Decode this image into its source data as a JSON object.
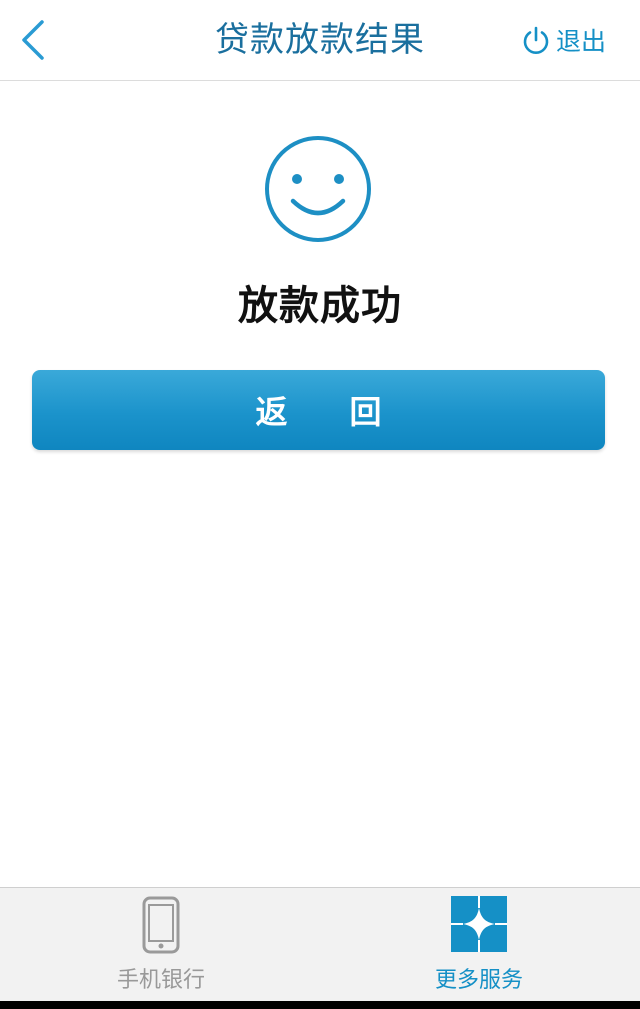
{
  "header": {
    "title": "贷款放款结果",
    "back_icon": "chevron-left-icon",
    "logout_icon": "power-icon",
    "logout_label": "退出"
  },
  "result": {
    "icon": "smiley-face-icon",
    "message": "放款成功"
  },
  "actions": {
    "return_label": "返回"
  },
  "tabbar": {
    "items": [
      {
        "label": "手机银行",
        "icon": "mobile-phone-icon",
        "active": false
      },
      {
        "label": "更多服务",
        "icon": "grid-services-icon",
        "active": true
      }
    ]
  },
  "colors": {
    "accent": "#1590c6",
    "title": "#1a6f9e",
    "button_top": "#3aa9d9",
    "button_bottom": "#0f86c0",
    "inactive_tab": "#999999"
  }
}
